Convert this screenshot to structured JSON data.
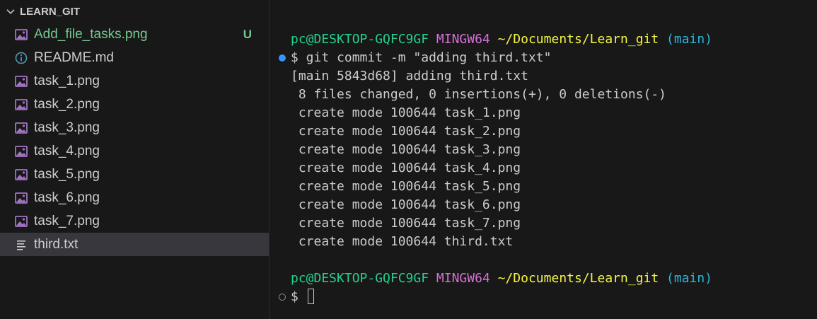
{
  "colors": {
    "background": "#181818",
    "selected_row": "#37373d",
    "untracked_green": "#73c991",
    "prompt_user": "#23d18b",
    "prompt_env": "#d670d6",
    "prompt_path": "#f5f543",
    "prompt_branch": "#29b8db",
    "text": "#cccccc",
    "decoration_success": "#3794ff"
  },
  "explorer": {
    "folder_name": "LEARN_GIT",
    "files": [
      {
        "name": "Add_file_tasks.png",
        "icon": "image-icon",
        "status": "U"
      },
      {
        "name": "README.md",
        "icon": "info-icon",
        "status": ""
      },
      {
        "name": "task_1.png",
        "icon": "image-icon",
        "status": ""
      },
      {
        "name": "task_2.png",
        "icon": "image-icon",
        "status": ""
      },
      {
        "name": "task_3.png",
        "icon": "image-icon",
        "status": ""
      },
      {
        "name": "task_4.png",
        "icon": "image-icon",
        "status": ""
      },
      {
        "name": "task_5.png",
        "icon": "image-icon",
        "status": ""
      },
      {
        "name": "task_6.png",
        "icon": "image-icon",
        "status": ""
      },
      {
        "name": "task_7.png",
        "icon": "image-icon",
        "status": ""
      },
      {
        "name": "third.txt",
        "icon": "text-file-icon",
        "status": "",
        "selected": true
      }
    ]
  },
  "terminal": {
    "prompt1": {
      "user": "pc@DESKTOP-GQFC9GF",
      "env": "MINGW64",
      "path": "~/Documents/Learn_git",
      "branch": "(main)"
    },
    "command1": "$ git commit -m \"adding third.txt\"",
    "output": [
      "[main 5843d68] adding third.txt",
      " 8 files changed, 0 insertions(+), 0 deletions(-)",
      " create mode 100644 task_1.png",
      " create mode 100644 task_2.png",
      " create mode 100644 task_3.png",
      " create mode 100644 task_4.png",
      " create mode 100644 task_5.png",
      " create mode 100644 task_6.png",
      " create mode 100644 task_7.png",
      " create mode 100644 third.txt"
    ],
    "prompt2": {
      "user": "pc@DESKTOP-GQFC9GF",
      "env": "MINGW64",
      "path": "~/Documents/Learn_git",
      "branch": "(main)"
    },
    "command2": "$ "
  }
}
